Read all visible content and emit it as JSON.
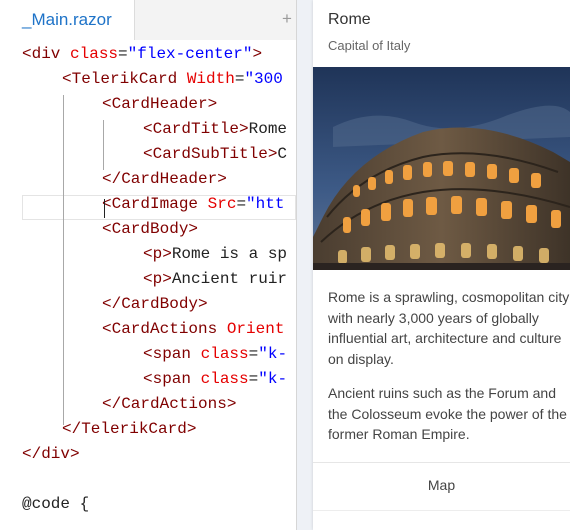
{
  "editor": {
    "tab_label": "_Main.razor",
    "add_tab_symbol": "+",
    "lines": [
      [
        [
          "tag",
          "<div "
        ],
        [
          "attr",
          "class"
        ],
        [
          "txt",
          "="
        ],
        [
          "str",
          "\"flex-center\""
        ],
        [
          "tag",
          ">"
        ]
      ],
      [
        [
          "tag",
          "<TelerikCard "
        ],
        [
          "attr",
          "Width"
        ],
        [
          "txt",
          "="
        ],
        [
          "str",
          "\"300"
        ]
      ],
      [
        [
          "tag",
          "<CardHeader>"
        ]
      ],
      [
        [
          "tag",
          "<CardTitle>"
        ],
        [
          "txt",
          "Rome"
        ]
      ],
      [
        [
          "tag",
          "<CardSubTitle>"
        ],
        [
          "txt",
          "C"
        ]
      ],
      [
        [
          "tag",
          "</CardHeader>"
        ]
      ],
      [
        [
          "tag",
          "<CardImage "
        ],
        [
          "attr",
          "Src"
        ],
        [
          "txt",
          "="
        ],
        [
          "str",
          "\"htt"
        ]
      ],
      [
        [
          "tag",
          "<CardBody>"
        ]
      ],
      [
        [
          "tag",
          "<p>"
        ],
        [
          "txt",
          "Rome is a sp"
        ]
      ],
      [
        [
          "tag",
          "<p>"
        ],
        [
          "txt",
          "Ancient ruir"
        ]
      ],
      [
        [
          "tag",
          "</CardBody>"
        ]
      ],
      [
        [
          "tag",
          "<CardActions "
        ],
        [
          "attr",
          "Orient"
        ]
      ],
      [
        [
          "tag",
          "<span "
        ],
        [
          "attr",
          "class"
        ],
        [
          "txt",
          "="
        ],
        [
          "str",
          "\"k-"
        ]
      ],
      [
        [
          "tag",
          "<span "
        ],
        [
          "attr",
          "class"
        ],
        [
          "txt",
          "="
        ],
        [
          "str",
          "\"k-"
        ]
      ],
      [
        [
          "tag",
          "</CardActions>"
        ]
      ],
      [
        [
          "tag",
          "</TelerikCard>"
        ]
      ],
      [
        [
          "tag",
          "</div>"
        ]
      ],
      [],
      [
        [
          "txt",
          "@code {"
        ]
      ]
    ]
  },
  "card": {
    "title": "Rome",
    "subtitle": "Capital of Italy",
    "body_paragraphs": [
      "Rome is a sprawling, cosmopolitan city with nearly 3,000 years of globally influential art, architecture and culture on display.",
      "Ancient ruins such as the Forum and the Colosseum evoke the power of the former Roman Empire."
    ],
    "action_label": "Map"
  },
  "colors": {
    "tag": "#800000",
    "attribute": "#e50000",
    "string": "#0000ff",
    "tab_text": "#1e73c8"
  }
}
